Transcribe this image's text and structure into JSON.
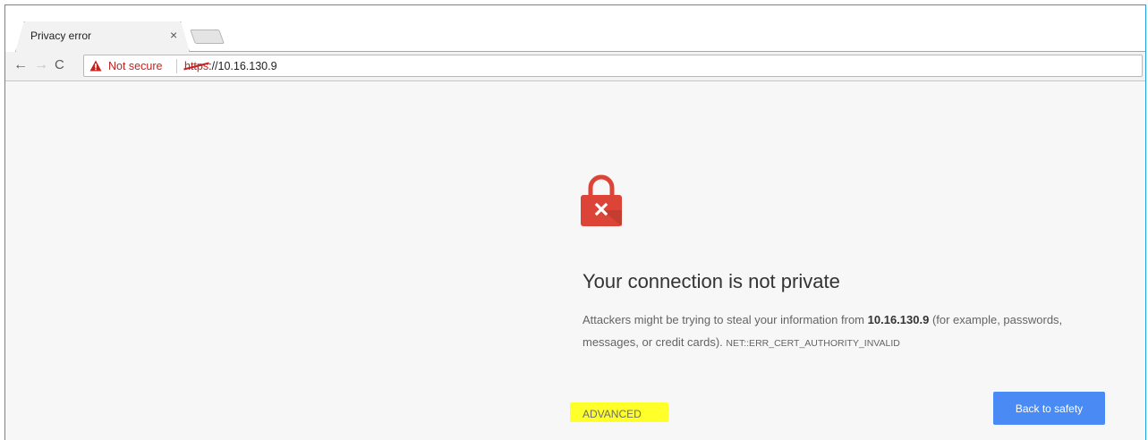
{
  "tab": {
    "title": "Privacy error",
    "close_glyph": "×"
  },
  "toolbar": {
    "back_glyph": "←",
    "forward_glyph": "→",
    "reload_glyph": "C",
    "security_label": "Not secure",
    "url_scheme": "https",
    "url_rest": "://10.16.130.9"
  },
  "page": {
    "heading": "Your connection is not private",
    "message_before": "Attackers might be trying to steal your information from ",
    "host": "10.16.130.9",
    "message_after": " (for example, passwords, messages, or credit cards). ",
    "error_code": "NET::ERR_CERT_AUTHORITY_INVALID",
    "advanced_label": "ADVANCED",
    "back_button": "Back to safety"
  },
  "colors": {
    "frame_border": "#1ba1e2",
    "warning_red": "#c5221f",
    "lock_red": "#db4437",
    "button_blue": "#4a8af4",
    "highlight_yellow": "#ffff2a"
  },
  "icons": {
    "warning": "warning-triangle-icon",
    "lock": "broken-lock-icon"
  }
}
